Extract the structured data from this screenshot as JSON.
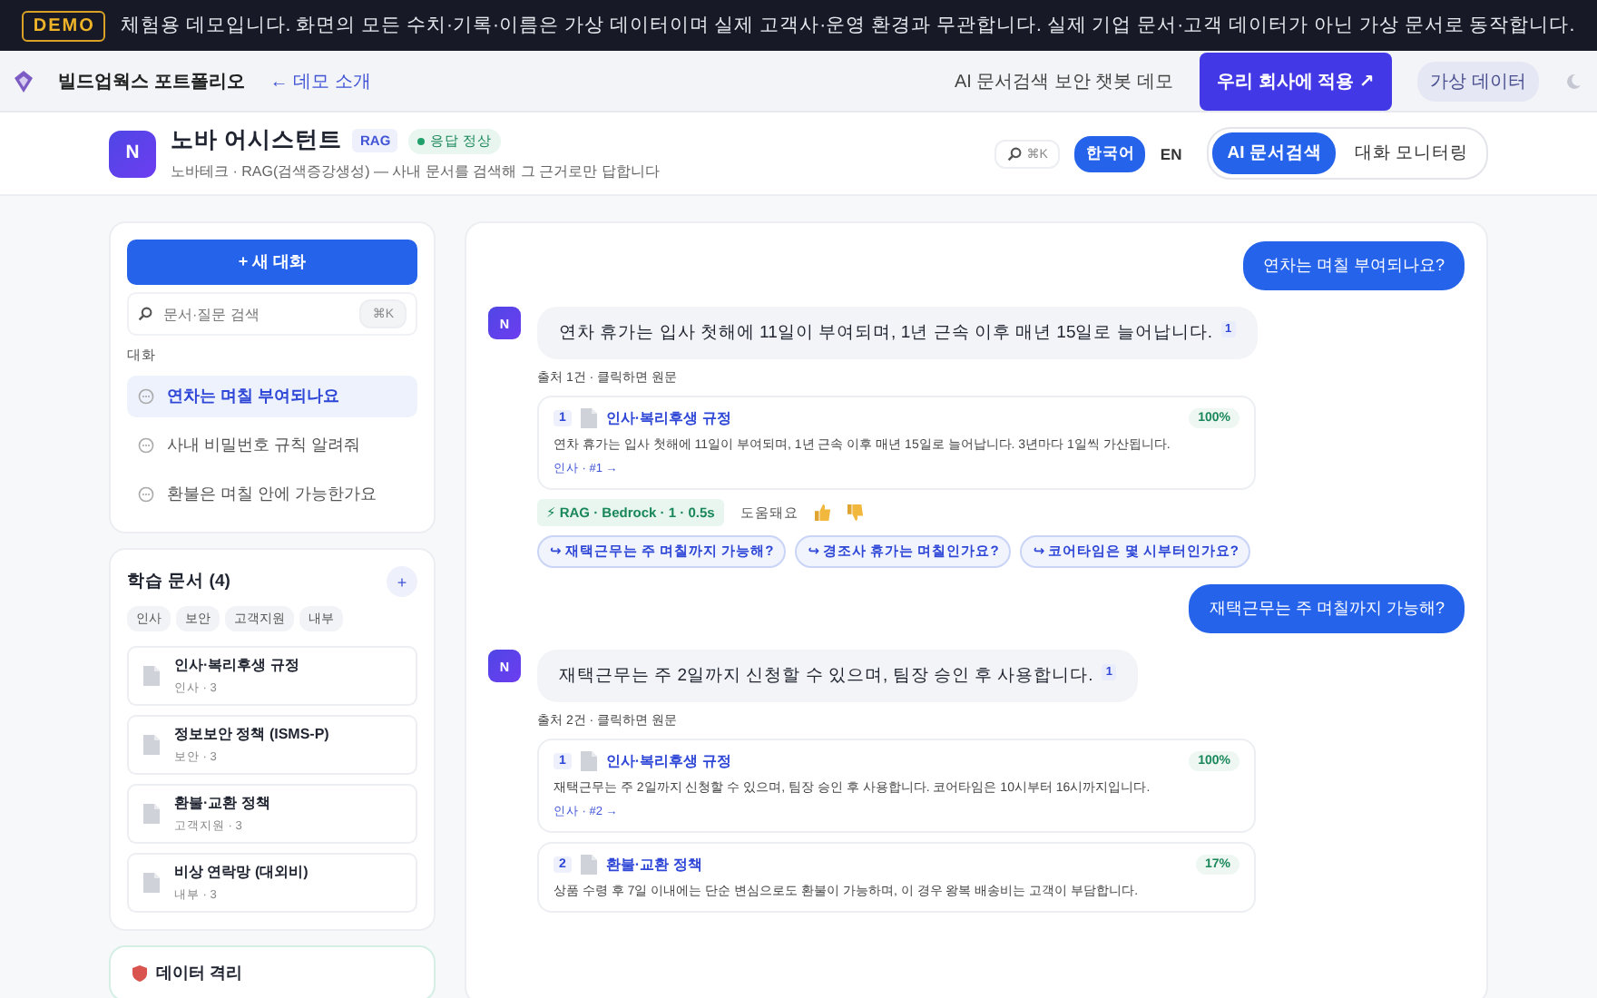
{
  "banner": {
    "badge": "DEMO",
    "text": "체험용 데모입니다. 화면의 모든 수치·기록·이름은 가상 데이터이며 실제 고객사·운영 환경과 무관합니다. 실제 기업 문서·고객 데이터가 아닌 가상 문서로 동작합니다."
  },
  "nav": {
    "brand": "빌드업웍스 포트폴리오",
    "back": "← 데모 소개",
    "subtitle": "AI 문서검색 보안 챗봇 데모",
    "cta": "우리 회사에 적용 ↗",
    "badge": "가상 데이터"
  },
  "header": {
    "avatar": "N",
    "title": "노바 어시스턴트",
    "tag": "RAG",
    "status": "응답 정상",
    "description": "노바테크 · RAG(검색증강생성) — 사내 문서를 검색해 그 근거로만 답합니다",
    "shortcut": "⌘K",
    "languages": [
      {
        "label": "한국어",
        "selected": true
      },
      {
        "label": "EN",
        "selected": false
      }
    ],
    "tabs": [
      {
        "label": "AI 문서검색",
        "selected": true
      },
      {
        "label": "대화 모니터링",
        "selected": false
      }
    ]
  },
  "sidebar": {
    "new_chat": "+ 새 대화",
    "search": {
      "placeholder": "문서·질문 검색",
      "shortcut": "⌘K"
    },
    "section": "대화",
    "conversations": [
      {
        "label": "연차는 며칠 부여되나요",
        "selected": true
      },
      {
        "label": "사내 비밀번호 규칙 알려줘",
        "selected": false
      },
      {
        "label": "환불은 며칠 안에 가능한가요",
        "selected": false
      }
    ],
    "documents": {
      "title": "학습 문서 (4)",
      "add": "+",
      "filters": [
        "인사",
        "보안",
        "고객지원",
        "내부"
      ],
      "items": [
        {
          "title": "인사·복리후생 규정",
          "meta": "인사 · 3"
        },
        {
          "title": "정보보안 정책 (ISMS-P)",
          "meta": "보안 · 3"
        },
        {
          "title": "환불·교환 정책",
          "meta": "고객지원 · 3"
        },
        {
          "title": "비상 연락망 (대외비)",
          "meta": "내부 · 3"
        }
      ]
    },
    "isolation": {
      "title": "데이터 격리"
    }
  },
  "messages": [
    {
      "kind": "user",
      "text": "연차는 며칠 부여되나요?"
    },
    {
      "kind": "assistant",
      "avatar": "N",
      "text": "연차 휴가는 입사 첫해에 11일이 부여되며, 1년 근속 이후 매년 15일로 늘어납니다.",
      "cite": "1",
      "sources_label": "출처 1건 · 클릭하면 원문",
      "sources": [
        {
          "index": "1",
          "title": "인사·복리후생 규정",
          "score": "100%",
          "excerpt": "연차 휴가는 입사 첫해에 11일이 부여되며, 1년 근속 이후 매년 15일로 늘어납니다. 3년마다 1일씩 가산됩니다.",
          "link": "인사 · #1 →"
        }
      ],
      "engine": "⚡ RAG · Bedrock · 1 · 0.5s",
      "feedback": "도움돼요",
      "followups": [
        "↪ 재택근무는 주 며칠까지 가능해?",
        "↪ 경조사 휴가는 며칠인가요?",
        "↪ 코어타임은 몇 시부터인가요?"
      ]
    },
    {
      "kind": "user",
      "text": "재택근무는 주 며칠까지 가능해?"
    },
    {
      "kind": "assistant",
      "avatar": "N",
      "text": "재택근무는 주 2일까지 신청할 수 있으며, 팀장 승인 후 사용합니다.",
      "cite": "1",
      "sources_label": "출처 2건 · 클릭하면 원문",
      "sources": [
        {
          "index": "1",
          "title": "인사·복리후생 규정",
          "score": "100%",
          "excerpt": "재택근무는 주 2일까지 신청할 수 있으며, 팀장 승인 후 사용합니다. 코어타임은 10시부터 16시까지입니다.",
          "link": "인사 · #2 →"
        },
        {
          "index": "2",
          "title": "환불·교환 정책",
          "score": "17%",
          "excerpt": "상품 수령 후 7일 이내에는 단순 변심으로도 환불이 가능하며, 이 경우 왕복 배송비는 고객이 부담합니다."
        }
      ]
    }
  ]
}
